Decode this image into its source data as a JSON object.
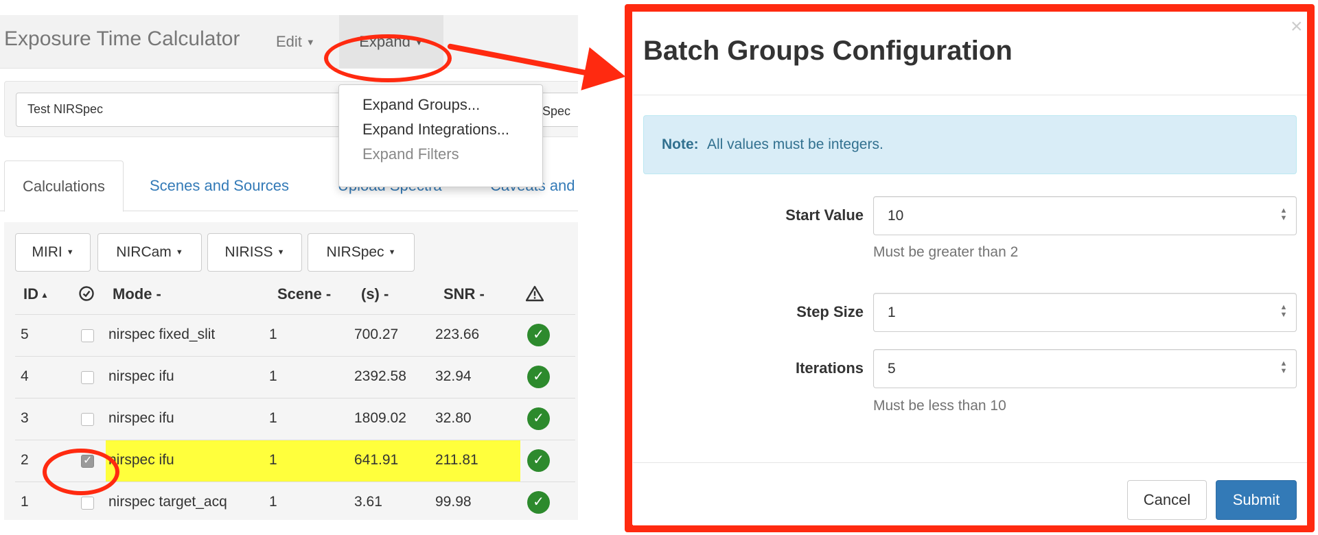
{
  "app": {
    "title": "Exposure Time Calculator",
    "menu": {
      "edit_label": "Edit",
      "expand_label": "Expand",
      "expand_items": [
        {
          "label": "Expand Groups...",
          "enabled": true
        },
        {
          "label": "Expand Integrations...",
          "enabled": true
        },
        {
          "label": "Expand Filters",
          "enabled": false
        }
      ]
    },
    "workbook_name": "Test NIRSpec",
    "workbook_name_tail": "Spec",
    "tabs": [
      "Calculations",
      "Scenes and Sources",
      "Upload Spectra",
      "Caveats and"
    ],
    "active_tab": "Calculations",
    "instrument_buttons": [
      "MIRI",
      "NIRCam",
      "NIRISS",
      "NIRSpec"
    ],
    "table": {
      "headers": {
        "id": "ID",
        "mode": "Mode -",
        "scene": "Scene -",
        "time": "(s) -",
        "snr": "SNR -"
      },
      "sort_indicator": "▲",
      "rows": [
        {
          "id": "5",
          "mode": "nirspec fixed_slit",
          "scene": "1",
          "time": "700.27",
          "snr": "223.66",
          "checked": false
        },
        {
          "id": "4",
          "mode": "nirspec ifu",
          "scene": "1",
          "time": "2392.58",
          "snr": "32.94",
          "checked": false
        },
        {
          "id": "3",
          "mode": "nirspec ifu",
          "scene": "1",
          "time": "1809.02",
          "snr": "32.80",
          "checked": false
        },
        {
          "id": "2",
          "mode": "nirspec ifu",
          "scene": "1",
          "time": "641.91",
          "snr": "211.81",
          "checked": true
        },
        {
          "id": "1",
          "mode": "nirspec target_acq",
          "scene": "1",
          "time": "3.61",
          "snr": "99.98",
          "checked": false
        }
      ]
    }
  },
  "modal": {
    "title": "Batch Groups Configuration",
    "close_symbol": "×",
    "note_label": "Note:",
    "note_text": "All values must be integers.",
    "fields": {
      "start_value": {
        "label": "Start Value",
        "value": "10",
        "help": "Must be greater than 2"
      },
      "step_size": {
        "label": "Step Size",
        "value": "1"
      },
      "iterations": {
        "label": "Iterations",
        "value": "5",
        "help": "Must be less than 10"
      }
    },
    "cancel_label": "Cancel",
    "submit_label": "Submit"
  },
  "colors": {
    "annotation_red": "#ff2a10",
    "primary": "#337ab7",
    "highlight": "#ffff3c",
    "success": "#2d8a2d",
    "info_bg": "#d9edf7"
  },
  "icons": [
    "caret-down-icon",
    "check-circle-icon",
    "warning-icon",
    "close-icon",
    "spinner-icon"
  ]
}
